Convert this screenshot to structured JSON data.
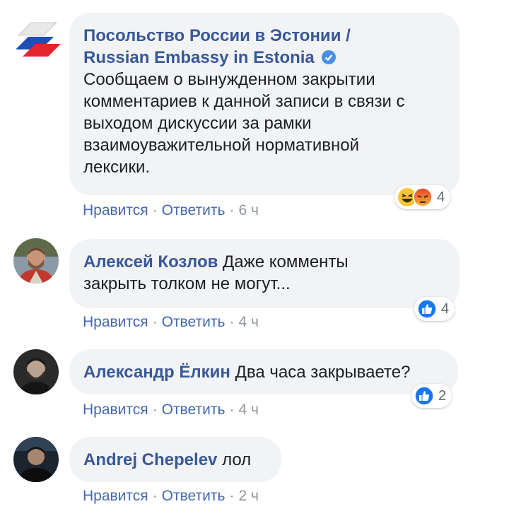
{
  "comments": [
    {
      "author": "Посольство России в Эстонии /",
      "author_line2": "Russian Embassy in Estonia",
      "verified": true,
      "text_lines": [
        "Сообщаем о вынужденном закрытии",
        "комментариев к данной записи в связи с",
        "выходом дискуссии за рамки",
        "взаимоуважительной нормативной",
        "лексики."
      ],
      "like_label": "Нравится",
      "reply_label": "Ответить",
      "time": "6 ч",
      "reactions": [
        "haha-icon",
        "angry-icon"
      ],
      "reaction_count": "4"
    },
    {
      "author": "Алексей Козлов",
      "text_first": "Даже комменты",
      "text_second": "закрыть толком не могут...",
      "like_label": "Нравится",
      "reply_label": "Ответить",
      "time": "4 ч",
      "reactions": [
        "like-icon"
      ],
      "reaction_count": "4"
    },
    {
      "author": "Александр Ёлкин",
      "text": "Два часа закрываете?",
      "like_label": "Нравится",
      "reply_label": "Ответить",
      "time": "4 ч",
      "reactions": [
        "like-icon"
      ],
      "reaction_count": "2"
    },
    {
      "author": "Andrej Chepelev",
      "text": "лол",
      "like_label": "Нравится",
      "reply_label": "Ответить",
      "time": "2 ч"
    }
  ],
  "colors": {
    "author": "#385898",
    "link": "#4267b2",
    "bubble": "#f2f3f5",
    "like": "#1877f2",
    "meta": "#90949c"
  }
}
